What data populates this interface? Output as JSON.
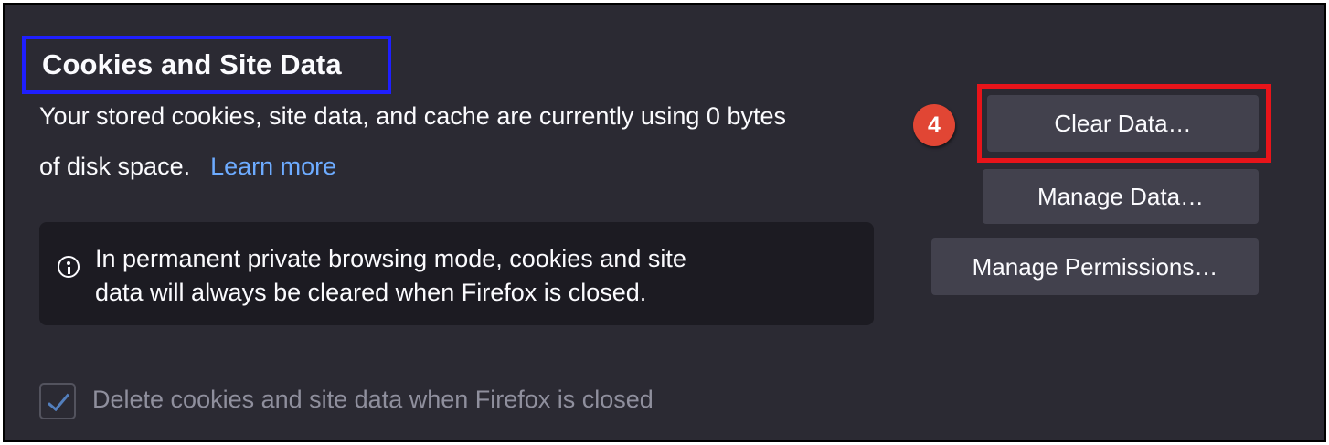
{
  "section": {
    "title": "Cookies and Site Data",
    "description_line1": "Your stored cookies, site data, and cache are currently using 0 bytes",
    "description_line2": "of disk space.",
    "learn_more": "Learn more"
  },
  "info_notice": {
    "icon": "info-icon",
    "line1": "In permanent private browsing mode, cookies and site",
    "line2": "data will always be cleared when Firefox is closed."
  },
  "buttons": {
    "clear_data": "Clear Data…",
    "manage_data": "Manage Data…",
    "manage_permissions": "Manage Permissions…"
  },
  "annotation": {
    "step_number": "4",
    "step_color": "#e14634",
    "highlight_title_color": "#1f1fff",
    "highlight_button_color": "#e8141a"
  },
  "checkbox": {
    "label": "Delete cookies and site data when Firefox is closed",
    "checked": true,
    "disabled": true
  },
  "colors": {
    "background": "#2b2a33",
    "button": "#42414d",
    "link": "#6dabff",
    "info_box": "#1c1b22"
  }
}
